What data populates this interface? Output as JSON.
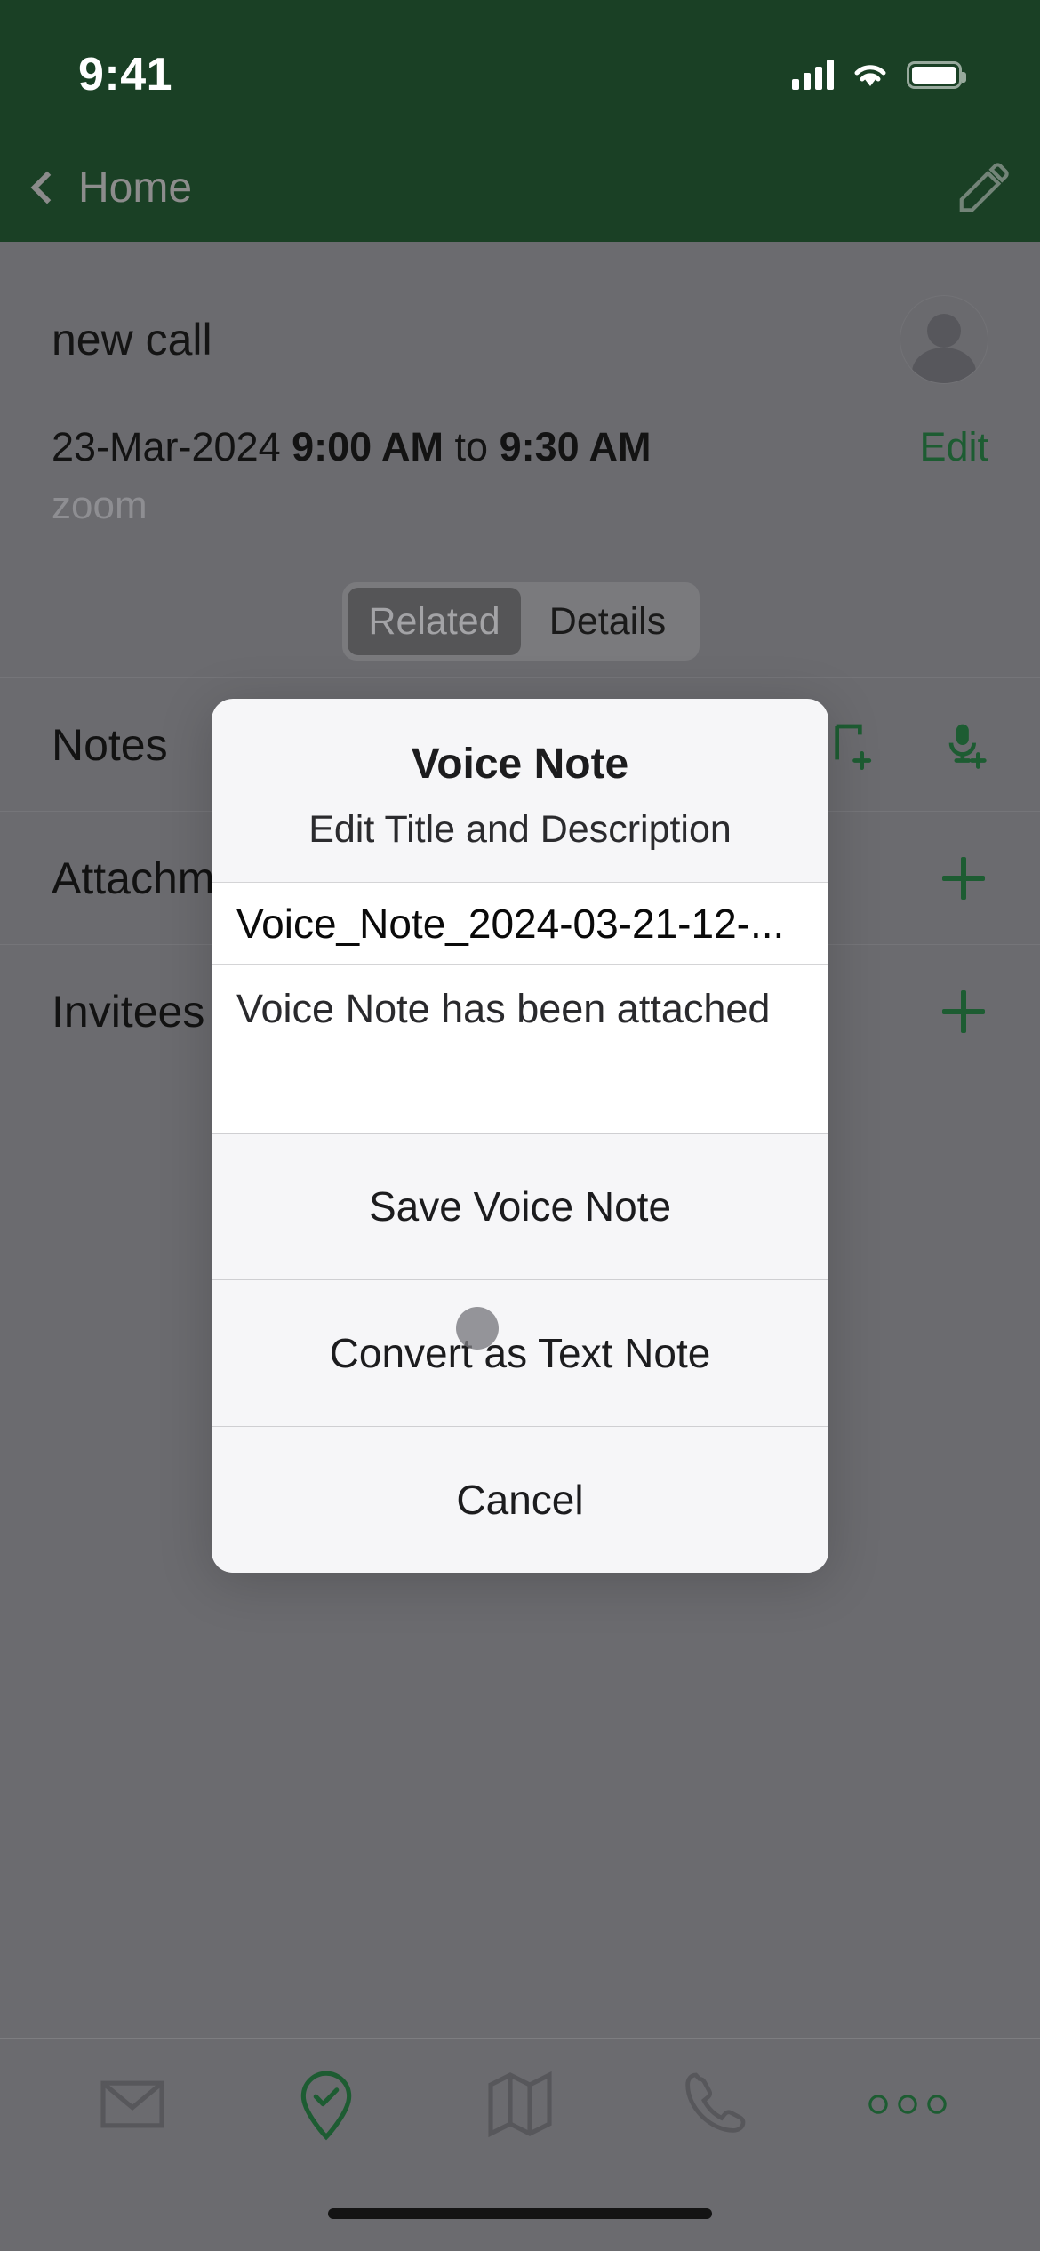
{
  "status_bar": {
    "time": "9:41",
    "icons": [
      "cellular-signal-icon",
      "wifi-icon",
      "battery-icon"
    ]
  },
  "nav_bar": {
    "back_label": "Home",
    "back_icon": "chevron-left-icon",
    "edit_icon": "pencil-icon"
  },
  "record": {
    "title": "new call",
    "avatar_icon": "person-avatar-icon",
    "date": "23-Mar-2024 ",
    "time_start": "9:00 AM",
    "time_separator": " to ",
    "time_end": "9:30 AM",
    "edit_link": "Edit",
    "platform": "zoom"
  },
  "segmented_control": {
    "tabs": [
      {
        "label": "Related",
        "selected": true
      },
      {
        "label": "Details",
        "selected": false
      }
    ]
  },
  "list_rows": [
    {
      "label": "Notes",
      "actions": [
        "note-add-icon",
        "mic-add-icon"
      ]
    },
    {
      "label": "Attachm",
      "actions": [
        "plus-icon"
      ]
    },
    {
      "label": "Invitees",
      "actions": [
        "plus-icon"
      ]
    }
  ],
  "dialog": {
    "title": "Voice Note",
    "message": "Edit Title and Description",
    "title_field": {
      "value": "Voice_Note_2024-03-21-12-...",
      "placeholder": "Title"
    },
    "description_field": {
      "value": "Voice Note has been attached",
      "placeholder": "Description"
    },
    "buttons": [
      {
        "label": "Save Voice Note"
      },
      {
        "label": "Convert as Text Note"
      },
      {
        "label": "Cancel"
      }
    ]
  },
  "tab_bar": {
    "items": [
      {
        "icon": "mail-icon",
        "active": false
      },
      {
        "icon": "location-check-icon",
        "active": true
      },
      {
        "icon": "map-icon",
        "active": false
      },
      {
        "icon": "phone-icon",
        "active": false
      },
      {
        "icon": "more-dots-icon",
        "active": true
      }
    ]
  },
  "colors": {
    "brand_green": "#1a4025",
    "accent_green": "#1d5c32",
    "dim_overlay": "#6b6b6f",
    "dialog_bg": "#f6f6f8"
  }
}
